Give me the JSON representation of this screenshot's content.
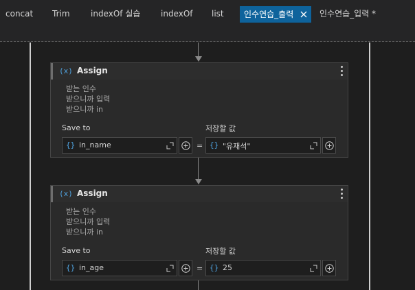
{
  "tabs": [
    {
      "label": "concat",
      "active": false
    },
    {
      "label": "Trim",
      "active": false
    },
    {
      "label": "indexOf 실습",
      "active": false
    },
    {
      "label": "indexOf",
      "active": false
    },
    {
      "label": "list",
      "active": false
    },
    {
      "label": "인수연습_출력",
      "active": true
    },
    {
      "label": "인수연습_입력 *",
      "active": false
    }
  ],
  "activities": [
    {
      "title": "Assign",
      "var_icon": "(x)",
      "annotation": [
        "받는 인수",
        "받으니까 입력",
        "받으니까 in"
      ],
      "to_label": "Save to",
      "value_label": "저장할 값",
      "to_value": "in_name",
      "value": "\"유재석\"",
      "brace": "{}",
      "equals": "="
    },
    {
      "title": "Assign",
      "var_icon": "(x)",
      "annotation": [
        "받는 인수",
        "받으니까 입력",
        "받으니까 in"
      ],
      "to_label": "Save to",
      "value_label": "저장할 값",
      "to_value": "in_age",
      "value": "25",
      "brace": "{}",
      "equals": "="
    }
  ],
  "colors": {
    "accent": "#0e639c",
    "brace": "#4fa3e0",
    "background": "#1e1e1e"
  }
}
